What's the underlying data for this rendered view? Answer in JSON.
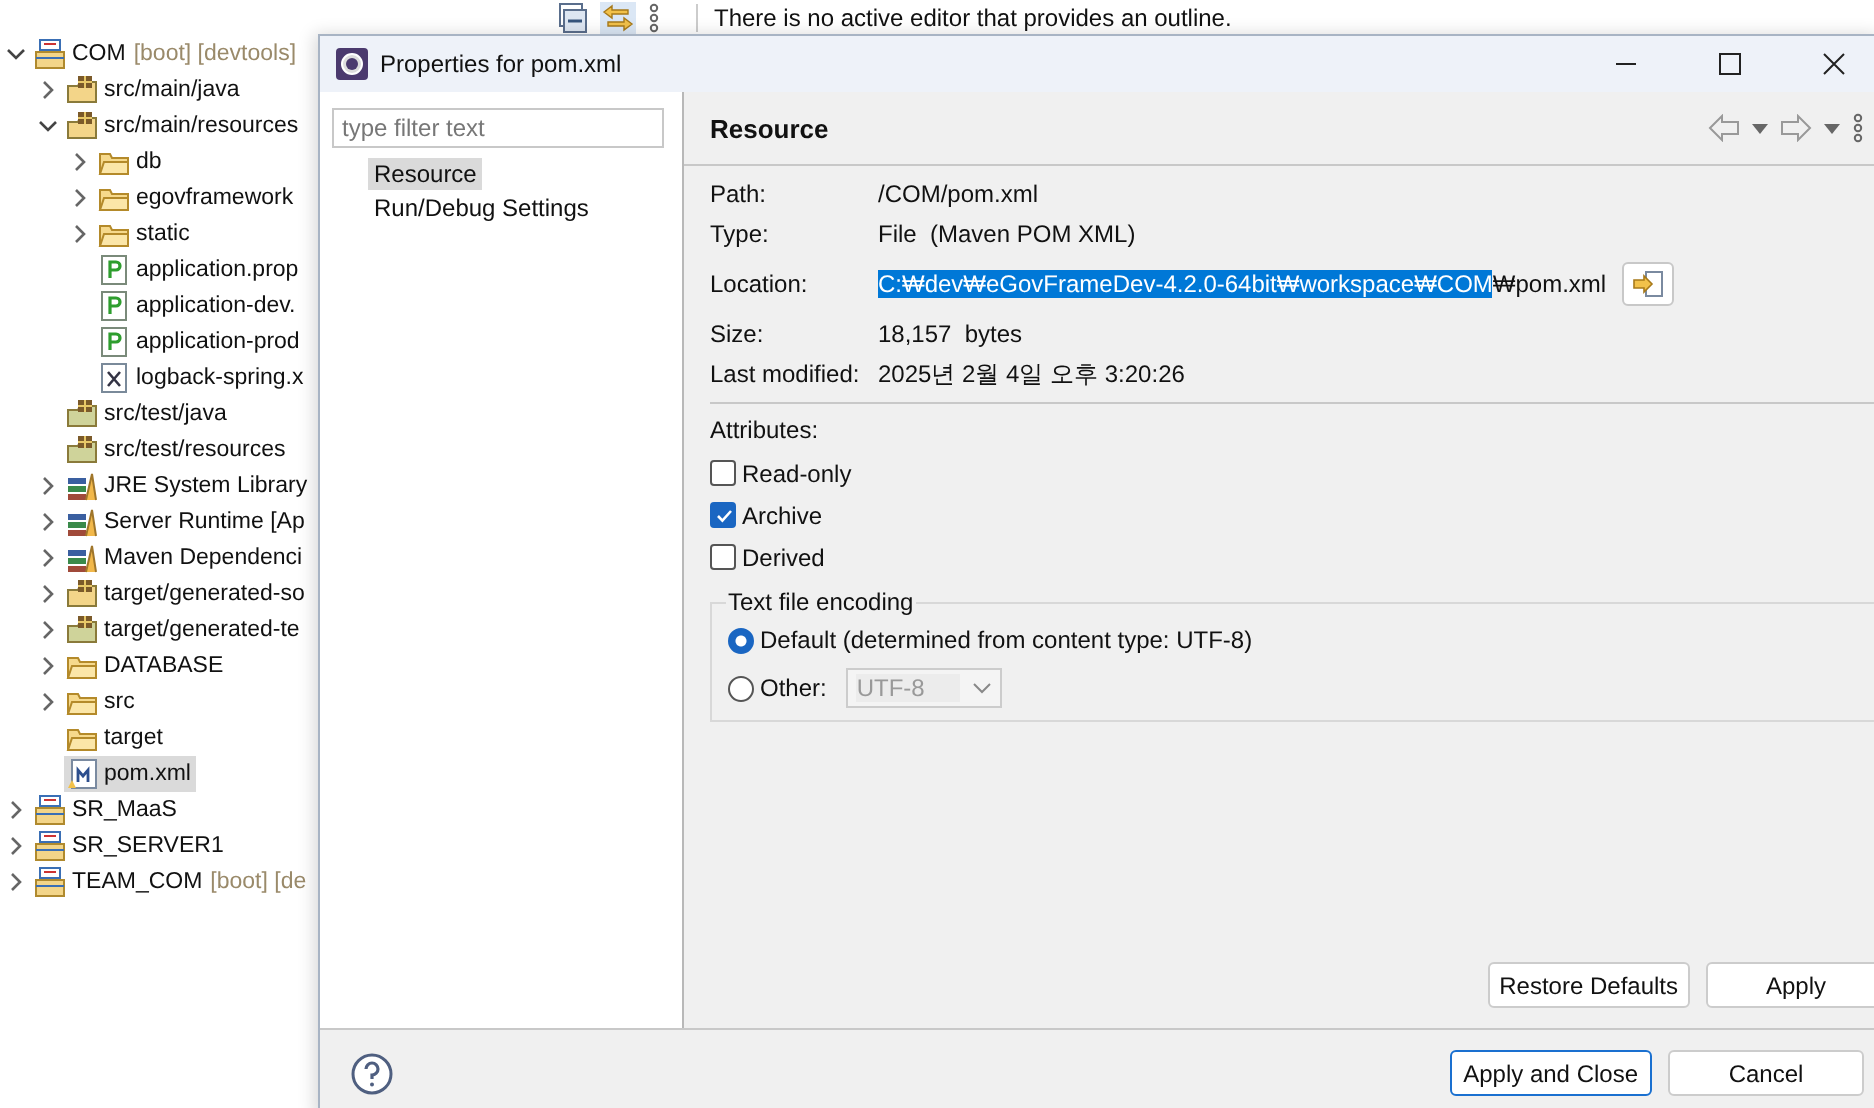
{
  "outline_view": {
    "message": "There is no active editor that provides an outline."
  },
  "project_explorer": {
    "items": [
      {
        "label": "COM",
        "decoration": "[boot] [devtools]",
        "kind": "project",
        "expanded": true,
        "selected": false,
        "children": [
          {
            "label": "src/main/java",
            "kind": "package",
            "expanded": false,
            "selected": false
          },
          {
            "label": "src/main/resources",
            "kind": "package",
            "expanded": true,
            "selected": false,
            "children": [
              {
                "label": "db",
                "kind": "folder",
                "expanded": false,
                "selected": false
              },
              {
                "label": "egovframework",
                "kind": "folder",
                "expanded": false,
                "selected": false
              },
              {
                "label": "static",
                "kind": "folder",
                "expanded": false,
                "selected": false
              },
              {
                "label": "application.prop",
                "kind": "properties",
                "selected": false
              },
              {
                "label": "application-dev.",
                "kind": "properties",
                "selected": false
              },
              {
                "label": "application-prod",
                "kind": "properties",
                "selected": false
              },
              {
                "label": "logback-spring.x",
                "kind": "xml",
                "selected": false
              }
            ]
          },
          {
            "label": "src/test/java",
            "kind": "package-test",
            "selected": false
          },
          {
            "label": "src/test/resources",
            "kind": "package-test",
            "selected": false
          },
          {
            "label": "JRE System Library",
            "kind": "library",
            "expanded": false,
            "selected": false
          },
          {
            "label": "Server Runtime [Ap",
            "kind": "library",
            "expanded": false,
            "selected": false
          },
          {
            "label": "Maven Dependenci",
            "kind": "library",
            "expanded": false,
            "selected": false
          },
          {
            "label": "target/generated-so",
            "kind": "package",
            "expanded": false,
            "selected": false
          },
          {
            "label": "target/generated-te",
            "kind": "package-test",
            "expanded": false,
            "selected": false
          },
          {
            "label": "DATABASE",
            "kind": "folder",
            "expanded": false,
            "selected": false
          },
          {
            "label": "src",
            "kind": "folder",
            "expanded": false,
            "selected": false
          },
          {
            "label": "target",
            "kind": "folder",
            "selected": false
          },
          {
            "label": "pom.xml",
            "kind": "pom",
            "selected": true
          }
        ]
      },
      {
        "label": "SR_MaaS",
        "kind": "project",
        "expanded": false,
        "selected": false
      },
      {
        "label": "SR_SERVER1",
        "kind": "project",
        "expanded": false,
        "selected": false
      },
      {
        "label": "TEAM_COM",
        "decoration": "[boot] [de",
        "kind": "project",
        "expanded": false,
        "selected": false
      }
    ]
  },
  "dialog": {
    "title": "Properties for pom.xml",
    "filter": {
      "placeholder": "type filter text"
    },
    "pages": [
      {
        "label": "Resource",
        "selected": true
      },
      {
        "label": "Run/Debug Settings",
        "selected": false
      }
    ],
    "page_title": "Resource",
    "properties": [
      {
        "label": "Path:",
        "value": "/COM/pom.xml"
      },
      {
        "label": "Type:",
        "value": "File  (Maven POM XML)"
      }
    ],
    "location": {
      "label": "Location:",
      "selected_text": "C:₩dev₩eGovFrameDev-4.2.0-64bit₩workspace₩COM",
      "rest_text": "₩pom.xml"
    },
    "details": [
      {
        "label": "Size:",
        "value": "18,157  bytes"
      },
      {
        "label": "Last modified:",
        "value": "2025년 2월 4일 오후 3:20:26"
      }
    ],
    "attributes_label": "Attributes:",
    "attributes": [
      {
        "label": "Read-only",
        "checked": false
      },
      {
        "label": "Archive",
        "checked": true
      },
      {
        "label": "Derived",
        "checked": false
      }
    ],
    "encoding": {
      "title": "Text file encoding",
      "options": [
        {
          "label": "Default (determined from content type: UTF-8)",
          "selected": true
        },
        {
          "label": "Other:",
          "selected": false
        }
      ],
      "combo_value": "UTF-8",
      "combo_disabled": true
    },
    "page_buttons": [
      "Restore Defaults",
      "Apply"
    ],
    "buttons": [
      {
        "label": "Apply and Close",
        "default": true
      },
      {
        "label": "Cancel",
        "default": false
      }
    ]
  }
}
